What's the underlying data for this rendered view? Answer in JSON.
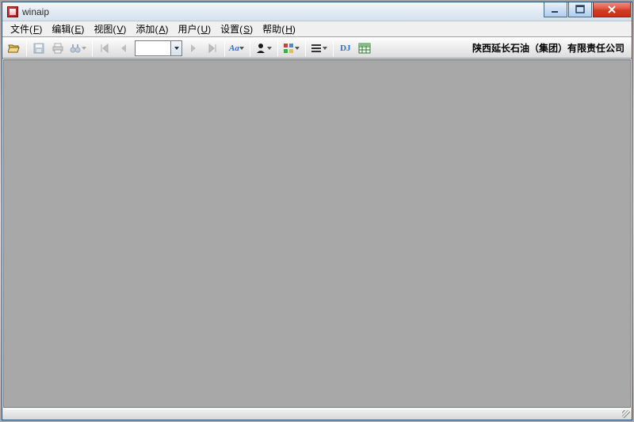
{
  "window": {
    "title": "winaip"
  },
  "menu": {
    "items": [
      {
        "label": "文件",
        "key": "F"
      },
      {
        "label": "编辑",
        "key": "E"
      },
      {
        "label": "视图",
        "key": "V"
      },
      {
        "label": "添加",
        "key": "A"
      },
      {
        "label": "用户",
        "key": "U"
      },
      {
        "label": "设置",
        "key": "S"
      },
      {
        "label": "帮助",
        "key": "H"
      }
    ]
  },
  "toolbar": {
    "open": "open",
    "save": "save",
    "print": "print",
    "find": "find",
    "zoom_value": "",
    "bookmark": "bookmark",
    "font_label": "Aa",
    "user": "user",
    "grid": "grid",
    "list": "list",
    "dj_label": "DJ",
    "table": "table"
  },
  "company": "陕西延长石油（集团）有限责任公司"
}
